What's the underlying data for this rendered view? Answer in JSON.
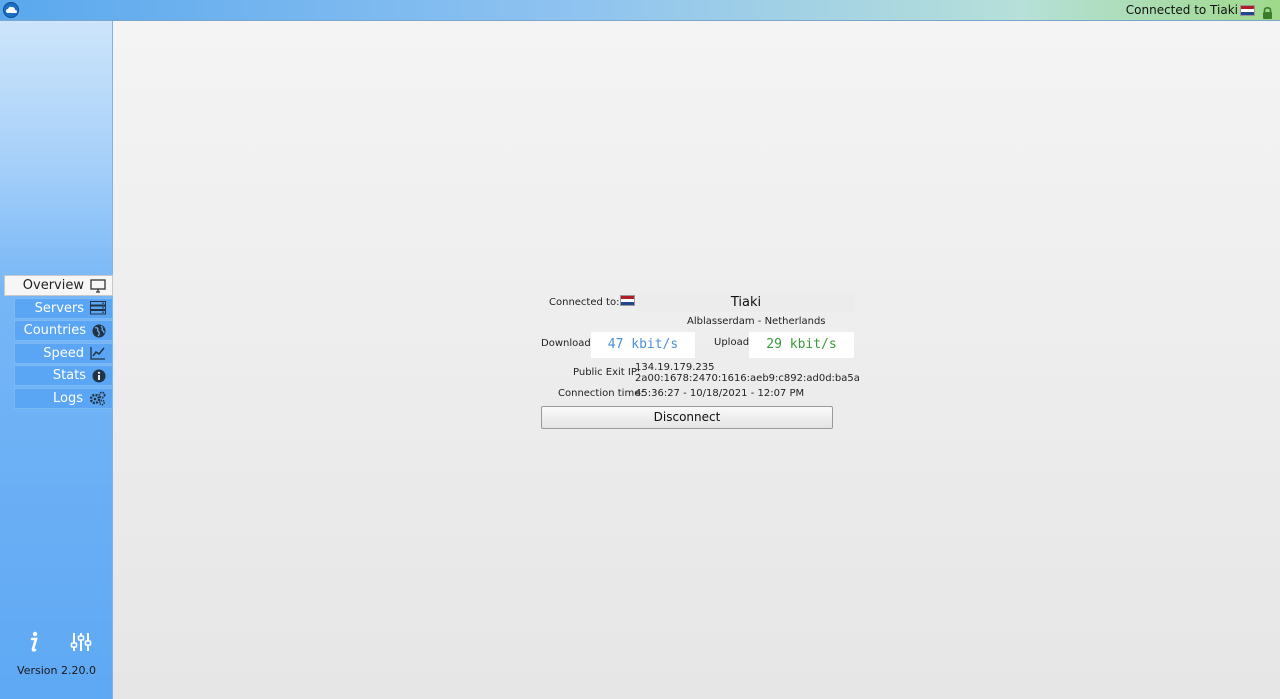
{
  "titlebar": {
    "status_text": "Connected to Tiaki",
    "logo_icon": "cloud-icon",
    "lock_icon": "lock-icon",
    "lock_color": "#3a7d2c"
  },
  "sidebar": {
    "items": [
      {
        "label": "Overview",
        "icon": "monitor-icon",
        "active": true
      },
      {
        "label": "Servers",
        "icon": "server-rack-icon",
        "active": false
      },
      {
        "label": "Countries",
        "icon": "globe-icon",
        "active": false
      },
      {
        "label": "Speed",
        "icon": "line-chart-icon",
        "active": false
      },
      {
        "label": "Stats",
        "icon": "info-circle-icon",
        "active": false
      },
      {
        "label": "Logs",
        "icon": "gears-icon",
        "active": false
      }
    ],
    "info_icon": "info-icon",
    "settings_icon": "sliders-icon",
    "version": "Version 2.20.0"
  },
  "overview": {
    "connected_to_label": "Connected to:",
    "server_name": "Tiaki",
    "location": "Alblasserdam - Netherlands",
    "download_label": "Download:",
    "download_value": "47 kbit/s",
    "download_color": "#4a90d9",
    "upload_label": "Upload:",
    "upload_value": "29 kbit/s",
    "upload_color": "#3a9a3a",
    "public_ip_label": "Public Exit IP:",
    "ipv4": "134.19.179.235",
    "ipv6": "2a00:1678:2470:1616:aeb9:c892:ad0d:ba5a",
    "connection_time_label": "Connection time:",
    "connection_time": "45:36:27 - 10/18/2021 - 12:07 PM",
    "disconnect_label": "Disconnect"
  },
  "colors": {
    "flag_red": "#ae1c28",
    "flag_white": "#ffffff",
    "flag_blue": "#21468b"
  }
}
